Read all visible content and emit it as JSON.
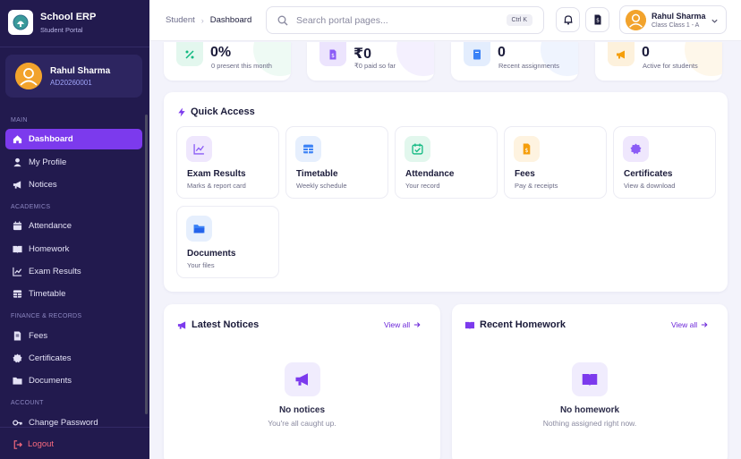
{
  "brand": {
    "title": "School ERP",
    "subtitle": "Student Portal"
  },
  "user": {
    "name": "Rahul Sharma",
    "id": "AD20260001",
    "class_label": "Class Class 1 - A"
  },
  "sidebar": {
    "main_label": "MAIN",
    "academics_label": "ACADEMICS",
    "finance_label": "FINANCE & RECORDS",
    "account_label": "ACCOUNT",
    "items": [
      {
        "label": "Dashboard",
        "icon": "home-icon"
      },
      {
        "label": "My Profile",
        "icon": "user-icon"
      },
      {
        "label": "Notices",
        "icon": "megaphone-icon"
      },
      {
        "label": "Attendance",
        "icon": "calendar-icon"
      },
      {
        "label": "Homework",
        "icon": "book-icon"
      },
      {
        "label": "Exam Results",
        "icon": "chart-line-icon"
      },
      {
        "label": "Timetable",
        "icon": "table-icon"
      },
      {
        "label": "Fees",
        "icon": "receipt-icon"
      },
      {
        "label": "Certificates",
        "icon": "badge-icon"
      },
      {
        "label": "Documents",
        "icon": "folder-icon"
      },
      {
        "label": "Change Password",
        "icon": "key-icon"
      }
    ],
    "logout_label": "Logout"
  },
  "topbar": {
    "breadcrumb": [
      "Student",
      "Dashboard"
    ],
    "search_placeholder": "Search portal pages...",
    "shortcut": "Ctrl K"
  },
  "stats": [
    {
      "value": "0%",
      "label": "0 present this month",
      "icon": "percent-icon",
      "color": "#10b981"
    },
    {
      "value": "₹0",
      "label": "₹0 paid so far",
      "icon": "fee-icon",
      "color": "#8b5cf6"
    },
    {
      "value": "0",
      "label": "Recent assignments",
      "icon": "book-icon",
      "color": "#3b82f6"
    },
    {
      "value": "0",
      "label": "Active for students",
      "icon": "megaphone-icon",
      "color": "#f59e0b"
    }
  ],
  "quick_access": {
    "title": "Quick Access",
    "tiles": [
      {
        "title": "Exam Results",
        "subtitle": "Marks & report card",
        "icon": "chart-line-icon"
      },
      {
        "title": "Timetable",
        "subtitle": "Weekly schedule",
        "icon": "table-icon"
      },
      {
        "title": "Attendance",
        "subtitle": "Your record",
        "icon": "calendar-check-icon"
      },
      {
        "title": "Fees",
        "subtitle": "Pay & receipts",
        "icon": "receipt-icon"
      },
      {
        "title": "Certificates",
        "subtitle": "View & download",
        "icon": "badge-icon"
      },
      {
        "title": "Documents",
        "subtitle": "Your files",
        "icon": "folder-icon"
      }
    ]
  },
  "notices": {
    "title": "Latest Notices",
    "view_all": "View all",
    "empty_title": "No notices",
    "empty_sub": "You're all caught up."
  },
  "homework": {
    "title": "Recent Homework",
    "view_all": "View all",
    "empty_title": "No homework",
    "empty_sub": "Nothing assigned right now."
  },
  "colors": {
    "sidebar": "#221a4e",
    "accent": "#7c3aed",
    "background": "#f3f3fb",
    "logout": "#f76a7e"
  }
}
